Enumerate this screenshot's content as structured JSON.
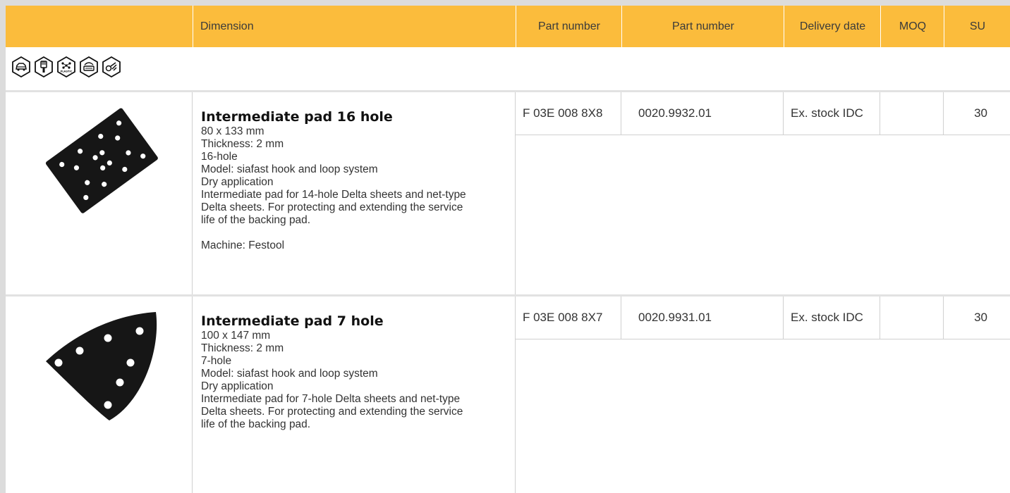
{
  "header": {
    "dimension": "Dimension",
    "part_number_1": "Part number",
    "part_number_2": "Part number",
    "delivery_date": "Delivery date",
    "moq": "MOQ",
    "su": "SU"
  },
  "application_icons": [
    {
      "icon": "car-body-icon"
    },
    {
      "icon": "paint-brush-icon"
    },
    {
      "icon": "plastic-icon",
      "label": "PLASTIC"
    },
    {
      "icon": "lacquer-icon"
    },
    {
      "icon": "special-application-icon"
    }
  ],
  "products": [
    {
      "title": "Intermediate pad 16 hole",
      "lines": [
        "80 x 133 mm",
        "Thickness: 2 mm",
        "16-hole",
        "Model: siafast hook and loop system",
        "Dry application",
        "Intermediate pad for 14-hole Delta sheets and net-type",
        "Delta sheets. For protecting and extending the service",
        "life of the backing pad."
      ],
      "machine": "Machine: Festool",
      "part_number_1": "F 03E 008 8X8",
      "part_number_2": "0020.9932.01",
      "delivery_date": "Ex. stock IDC",
      "moq": "",
      "su": "30",
      "image_icon": "rectangular-pad-image"
    },
    {
      "title": "Intermediate pad 7 hole",
      "lines": [
        "100 x 147 mm",
        "Thickness: 2 mm",
        "7-hole",
        "Model: siafast hook and loop system",
        "Dry application",
        "Intermediate pad for 7-hole Delta sheets and net-type",
        "Delta sheets. For protecting and extending the service",
        "life of the backing pad."
      ],
      "part_number_1": "F 03E 008 8X7",
      "part_number_2": "0020.9931.01",
      "delivery_date": "Ex. stock IDC",
      "moq": "",
      "su": "30",
      "image_icon": "delta-pad-image"
    }
  ],
  "colors": {
    "header_background": "#fbbc3c",
    "page_background": "#dcdcdc",
    "pad_color": "#161616"
  }
}
